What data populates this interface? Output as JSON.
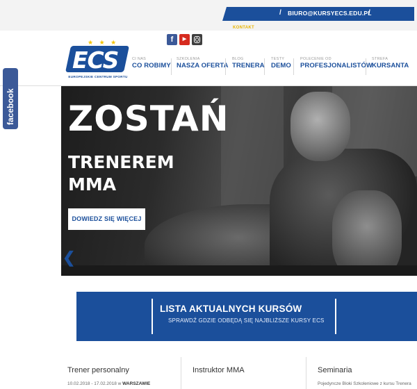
{
  "topbar": {
    "separator": "/",
    "email": "BIURO@KURSYECS.EDU.PL",
    "contact_label": "KONTAKT"
  },
  "social": {
    "facebook": "f",
    "youtube": "You Tube",
    "instagram_icon": "instagram-icon"
  },
  "logo": {
    "letters": "ECS",
    "tagline": "EUROPEJSKIE CENTRUM SPORTU",
    "stars": "★ ★ ★"
  },
  "nav": [
    {
      "small": "CI NAS",
      "label": "CO ROBIMY"
    },
    {
      "small": "SZKOLENIA",
      "label": "NASZA OFERTA"
    },
    {
      "small": "BLOG",
      "label": "TRENERA"
    },
    {
      "small": "TESTY",
      "label": "DEMO"
    },
    {
      "small": "POLECENIE OD",
      "label": "PROFESJONALISTÓW"
    },
    {
      "small": "STREFA",
      "label": "KURSANTA"
    }
  ],
  "facebook_tab": {
    "label": "facebook"
  },
  "hero": {
    "headline": "ZOSTAŃ",
    "sub_line1": "TRENEREM",
    "sub_line2": "MMA",
    "cta": "DOWIEDZ SIĘ WIĘCEJ",
    "prev_arrow": "❮"
  },
  "courses_banner": {
    "title": "LISTA AKTUALNYCH KURSÓW",
    "subtitle": "SPRAWDŹ GDZIE ODBĘDĄ SIĘ NAJBLIŻSZE KURSY ECS"
  },
  "columns": [
    {
      "heading": "Trener personalny",
      "detail_prefix": "10.02.2018 - 17.02.2018 w ",
      "detail_strong": "WARSZAWIE"
    },
    {
      "heading": "Instruktor MMA",
      "detail_prefix": "",
      "detail_strong": ""
    },
    {
      "heading": "Seminaria",
      "detail_prefix": "Pojedyncze Bloki Szkoleniowe z kursu Trenera",
      "detail_strong": ""
    }
  ],
  "colors": {
    "brand_blue": "#1b4f9b",
    "accent_yellow": "#e8b400",
    "facebook_blue": "#3b5998"
  }
}
